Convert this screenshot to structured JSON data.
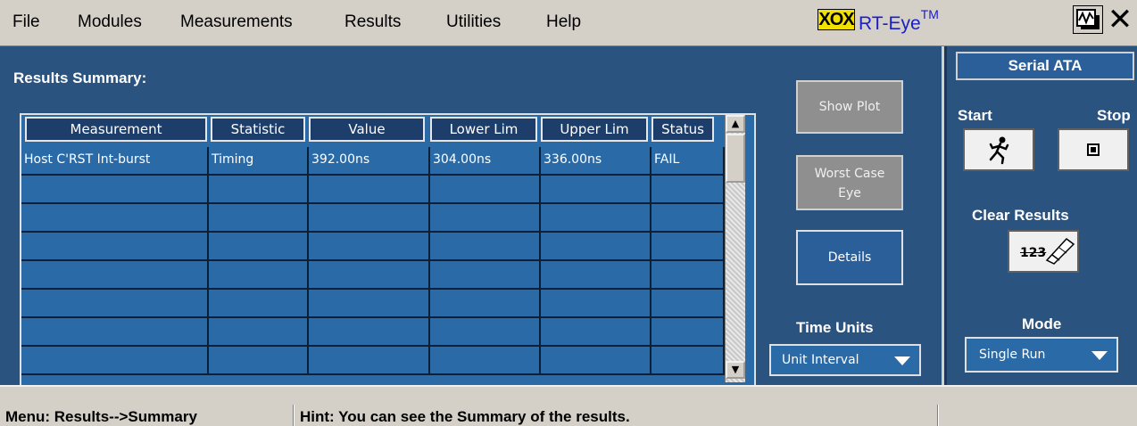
{
  "menu": {
    "items": [
      "File",
      "Modules",
      "Measurements",
      "Results",
      "Utilities",
      "Help"
    ],
    "logo_text": "XOX",
    "app_title": "RT-Eye",
    "app_title_sup": "TM"
  },
  "results": {
    "title": "Results Summary:",
    "columns": [
      "Measurement",
      "Statistic",
      "Value",
      "Lower Lim",
      "Upper Lim",
      "Status"
    ],
    "rows": [
      [
        "Host C'RST Int-burst",
        "Timing",
        "392.00ns",
        "304.00ns",
        "336.00ns",
        "FAIL"
      ],
      [
        "",
        "",
        "",
        "",
        "",
        ""
      ],
      [
        "",
        "",
        "",
        "",
        "",
        ""
      ],
      [
        "",
        "",
        "",
        "",
        "",
        ""
      ],
      [
        "",
        "",
        "",
        "",
        "",
        ""
      ],
      [
        "",
        "",
        "",
        "",
        "",
        ""
      ],
      [
        "",
        "",
        "",
        "",
        "",
        ""
      ],
      [
        "",
        "",
        "",
        "",
        "",
        ""
      ]
    ]
  },
  "buttons": {
    "show_plot": "Show Plot",
    "worst_case_line1": "Worst Case",
    "worst_case_line2": "Eye",
    "details": "Details"
  },
  "time_units": {
    "label": "Time Units",
    "value": "Unit Interval"
  },
  "side": {
    "title": "Serial ATA",
    "start": "Start",
    "stop": "Stop",
    "clear_results": "Clear Results",
    "clear_icon_text": "123",
    "mode_label": "Mode",
    "mode_value": "Single Run"
  },
  "status": {
    "menu": "Menu: Results-->Summary",
    "hint": "Hint: You can see the Summary of the results."
  },
  "colors": {
    "panel": "#2a537f",
    "header_cell": "#1d3e6b",
    "logo": "#f2e000",
    "title_blue": "#1a20c8"
  }
}
